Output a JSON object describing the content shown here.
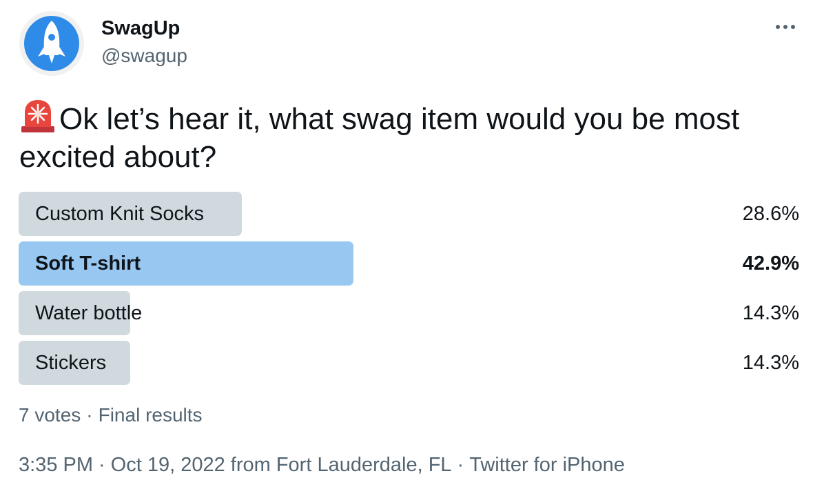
{
  "author": {
    "display_name": "SwagUp",
    "handle": "@swagup",
    "avatar_icon": "rocket-icon"
  },
  "more_icon": "more-options-icon",
  "tweet": {
    "emoji": "siren-icon",
    "text": "Ok let’s hear it, what swag item would you be most excited about?"
  },
  "poll": {
    "options": [
      {
        "label": "Custom Knit Socks",
        "percent_text": "28.6%",
        "percent": 28.6,
        "winner": false
      },
      {
        "label": "Soft T-shirt",
        "percent_text": "42.9%",
        "percent": 42.9,
        "winner": true
      },
      {
        "label": "Water bottle",
        "percent_text": "14.3%",
        "percent": 14.3,
        "winner": false
      },
      {
        "label": "Stickers",
        "percent_text": "14.3%",
        "percent": 14.3,
        "winner": false
      }
    ],
    "votes": "7 votes",
    "separator": "·",
    "status": "Final results"
  },
  "meta": {
    "time": "3:35 PM",
    "separator": "·",
    "date_location": "Oct 19, 2022 from Fort Lauderdale, FL",
    "client": "Twitter for iPhone"
  },
  "colors": {
    "bar": "#cfd9de",
    "winner_bar": "#98c8f2",
    "secondary_text": "#536471",
    "avatar_blue": "#2f8be8"
  }
}
